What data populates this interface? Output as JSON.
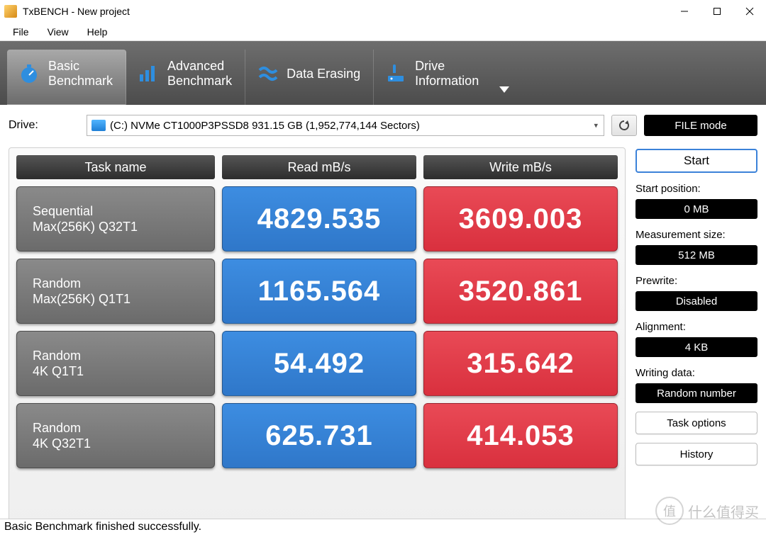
{
  "window": {
    "title": "TxBENCH - New project"
  },
  "menu": {
    "file": "File",
    "view": "View",
    "help": "Help"
  },
  "tabs": {
    "basic": {
      "line1": "Basic",
      "line2": "Benchmark"
    },
    "advanced": {
      "line1": "Advanced",
      "line2": "Benchmark"
    },
    "erase": {
      "line1": "Data Erasing"
    },
    "drive": {
      "line1": "Drive",
      "line2": "Information"
    }
  },
  "drive_row": {
    "label": "Drive:",
    "value": "(C:) NVMe CT1000P3PSSD8  931.15 GB (1,952,774,144 Sectors)",
    "file_mode": "FILE mode"
  },
  "headers": {
    "task": "Task name",
    "read": "Read mB/s",
    "write": "Write mB/s"
  },
  "rows": [
    {
      "name1": "Sequential",
      "name2": "Max(256K) Q32T1",
      "read": "4829.535",
      "write": "3609.003"
    },
    {
      "name1": "Random",
      "name2": "Max(256K) Q1T1",
      "read": "1165.564",
      "write": "3520.861"
    },
    {
      "name1": "Random",
      "name2": "4K Q1T1",
      "read": "54.492",
      "write": "315.642"
    },
    {
      "name1": "Random",
      "name2": "4K Q32T1",
      "read": "625.731",
      "write": "414.053"
    }
  ],
  "side": {
    "start": "Start",
    "start_position_label": "Start position:",
    "start_position_value": "0 MB",
    "measurement_size_label": "Measurement size:",
    "measurement_size_value": "512 MB",
    "prewrite_label": "Prewrite:",
    "prewrite_value": "Disabled",
    "alignment_label": "Alignment:",
    "alignment_value": "4 KB",
    "writing_data_label": "Writing data:",
    "writing_data_value": "Random number",
    "task_options": "Task options",
    "history": "History"
  },
  "status": "Basic Benchmark finished successfully.",
  "watermark": "什么值得买",
  "chart_data": {
    "type": "table",
    "title": "TxBENCH Basic Benchmark",
    "columns": [
      "Task name",
      "Read mB/s",
      "Write mB/s"
    ],
    "rows": [
      [
        "Sequential Max(256K) Q32T1",
        4829.535,
        3609.003
      ],
      [
        "Random Max(256K) Q1T1",
        1165.564,
        3520.861
      ],
      [
        "Random 4K Q1T1",
        54.492,
        315.642
      ],
      [
        "Random 4K Q32T1",
        625.731,
        414.053
      ]
    ]
  }
}
